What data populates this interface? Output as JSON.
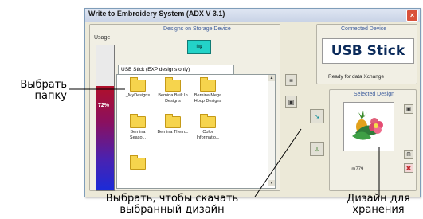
{
  "window": {
    "title": "Write to Embroidery System (ADX V 3.1)",
    "close_glyph": "×"
  },
  "usage": {
    "label": "Usage",
    "percent": 72,
    "percent_text": "72%"
  },
  "storage": {
    "caption": "Designs on Storage Device",
    "device_icon": "usb-device-icon",
    "tab_label": "USB Stick (EXP designs only)",
    "items": [
      {
        "label": "_MyDesigns"
      },
      {
        "label": "Bernina Built In Designs"
      },
      {
        "label": "Bernina Mega Hoop Designs"
      },
      {
        "label": "Bernina Seaso..."
      },
      {
        "label": "Bernina Them..."
      },
      {
        "label": "Color Informatio..."
      },
      {
        "label": ""
      }
    ]
  },
  "connected": {
    "caption": "Connected Device",
    "device_name": "USB Stick",
    "status": "Ready for data Xchange"
  },
  "selected": {
    "caption": "Selected Design",
    "design_name": "lm779"
  },
  "annotations": {
    "select_folder": "Выбрать папку",
    "select_download": "Выбрать, чтобы скачать выбранный дизайн",
    "storage_design": "Дизайн для хранения"
  },
  "colors": {
    "accent": "#23d3c8",
    "usage_top": "#b0102a",
    "usage_bottom": "#1b2bd8",
    "caption_text": "#3b5b9c"
  }
}
